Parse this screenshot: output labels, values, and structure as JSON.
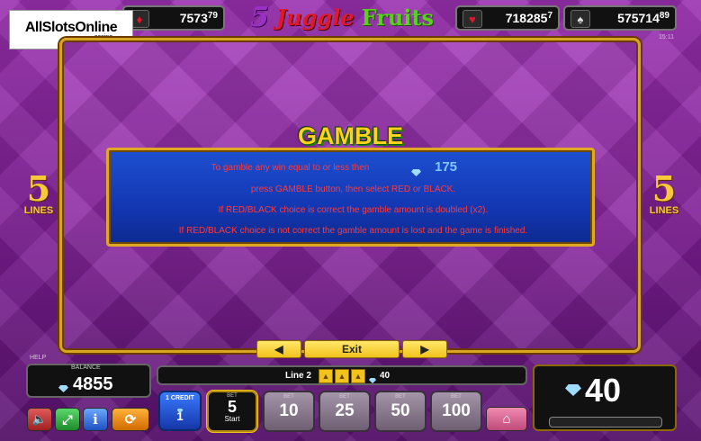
{
  "topbar": {
    "jackpot_left_value": "7573",
    "jackpot_left_cents": "79",
    "jackpot_hearts_value": "718285",
    "jackpot_hearts_cents": "7",
    "jackpot_spades_value": "575714",
    "jackpot_spades_cents": "89",
    "logo_main": "AllSlotsOnline",
    "logo_sub": ".casino",
    "title_number": "5",
    "title_word1": "Juggle",
    "title_word2": "Fruits",
    "clock": "15:11"
  },
  "lines_badge": {
    "number": "5",
    "label": "LINES"
  },
  "gamble": {
    "title": "GAMBLE",
    "line1": "To gamble any win equal to or less then",
    "amount": "175",
    "line2": "press GAMBLE button, then select RED or BLACK.",
    "line3": "If RED/BLACK choice is correct the gamble amount is doubled (x2).",
    "line4": "If RED/BLACK choice is not correct the gamble amount is lost and the game is finished."
  },
  "nav": {
    "prev": "◀",
    "exit": "Exit",
    "next": "▶"
  },
  "bottom": {
    "help_label": "HELP",
    "balance_label": "BALANCE",
    "balance_value": "4855",
    "line_info": "Line 2",
    "line_win": "40",
    "win_value": "40",
    "credit_label": "1 CREDIT",
    "credit_value": "1",
    "bet_label": "BET",
    "bet_value": "5",
    "bet_sub": "Start",
    "bets": [
      "10",
      "25",
      "50",
      "100"
    ],
    "bet_tag": "BET"
  },
  "colors": {
    "accent_gold": "#d9a520",
    "panel_purple": "#8a27a0",
    "gamble_blue": "#1337b3",
    "gamble_text_red": "#ff3a3a"
  },
  "icons": [
    "diamond-suit-icon",
    "heart-suit-icon",
    "spade-suit-icon",
    "gem-icon",
    "bell-icon",
    "sound-icon",
    "fullscreen-icon",
    "info-icon",
    "autoplay-icon",
    "home-icon"
  ]
}
